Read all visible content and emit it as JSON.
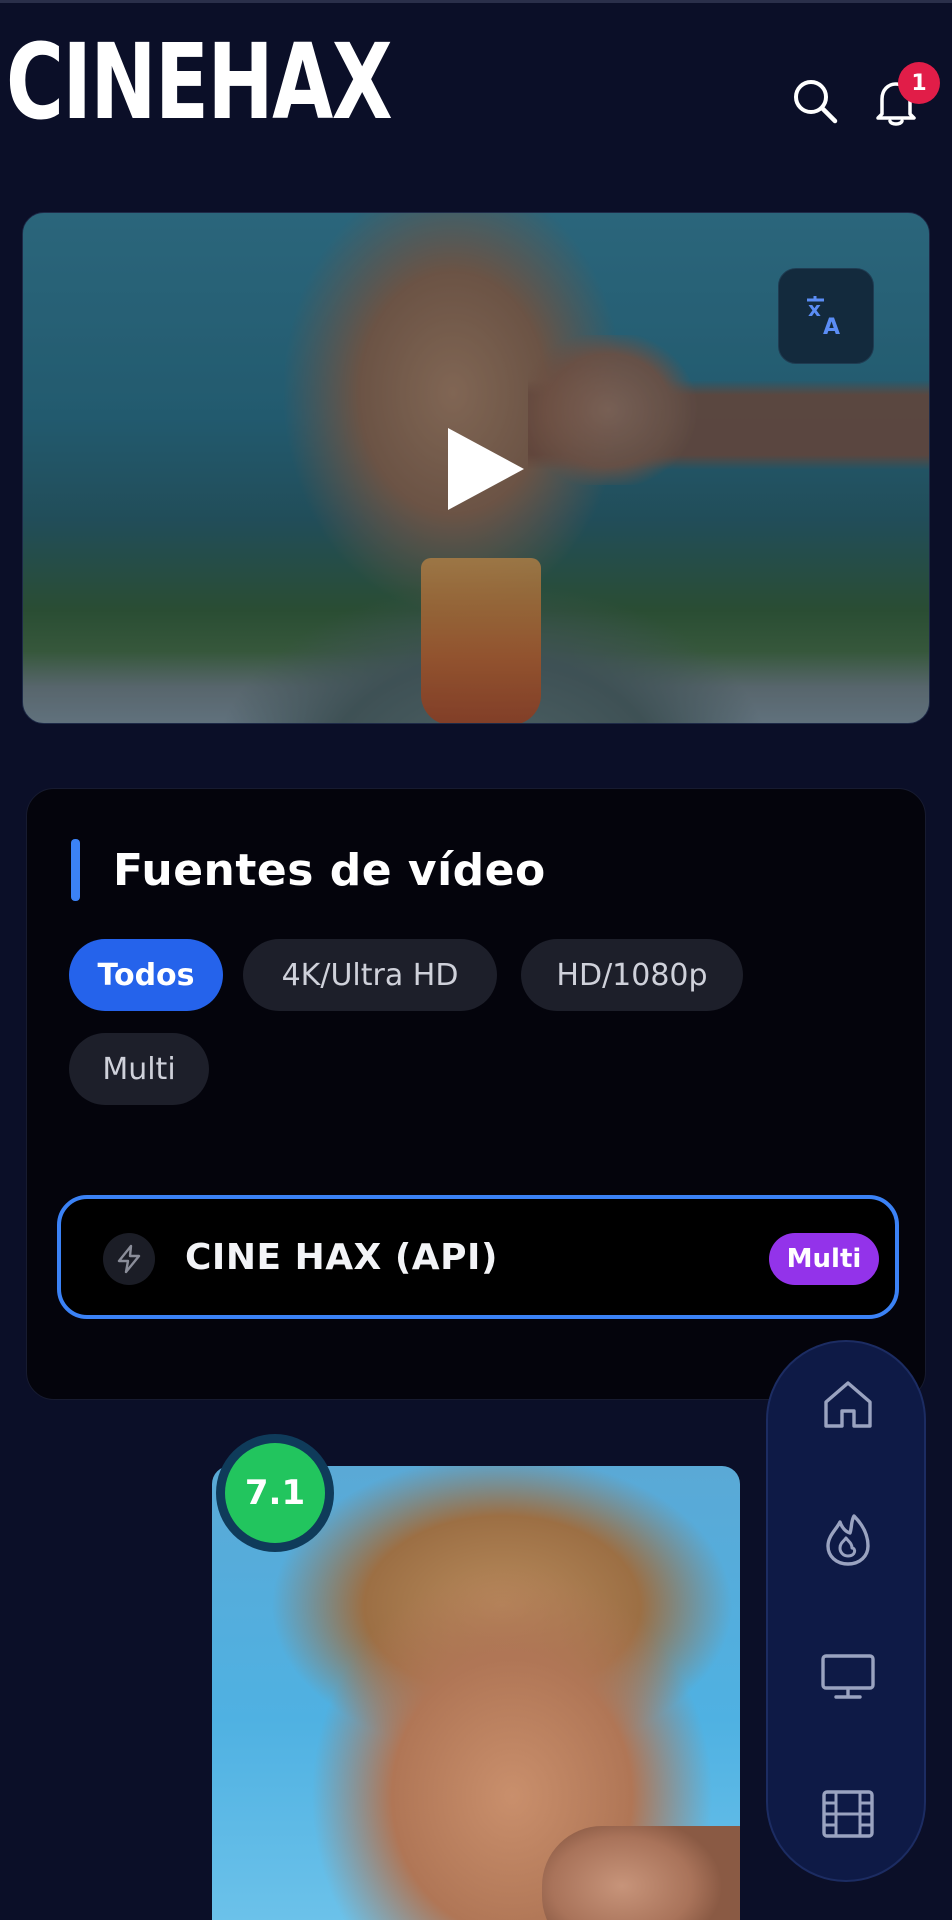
{
  "header": {
    "logo": "CINEHAX",
    "notification_count": "1",
    "search_icon": "search-icon",
    "bell_icon": "bell-icon"
  },
  "hero": {
    "translate_icon": "translate-icon",
    "play_icon": "play-icon"
  },
  "sources": {
    "title": "Fuentes de vídeo",
    "filters": [
      {
        "label": "Todos",
        "active": true
      },
      {
        "label": "4K/Ultra HD",
        "active": false
      },
      {
        "label": "HD/1080p",
        "active": false
      },
      {
        "label": "Multi",
        "active": false
      }
    ],
    "items": [
      {
        "name": "CINE HAX (API)",
        "badge": "Multi",
        "icon": "bolt-icon",
        "selected": true
      }
    ]
  },
  "poster": {
    "rating": "7.1"
  },
  "nav": {
    "items": [
      {
        "icon": "home-icon"
      },
      {
        "icon": "fire-icon"
      },
      {
        "icon": "tv-icon"
      },
      {
        "icon": "film-icon"
      }
    ]
  },
  "colors": {
    "background": "#0b0f28",
    "accent": "#3b82f6",
    "active_chip": "#2563eb",
    "multi_badge": "#9333ea",
    "rating": "#22c55e",
    "notification": "#e11d48"
  }
}
